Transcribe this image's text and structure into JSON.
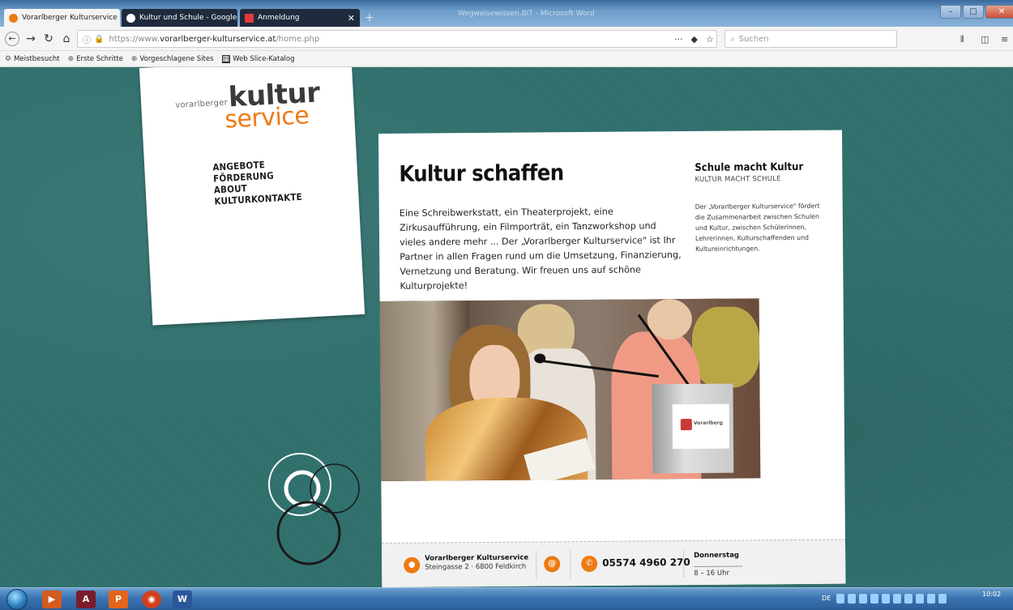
{
  "browser": {
    "tabs": [
      {
        "label": "Vorarlberger Kulturservice",
        "active": true
      },
      {
        "label": "Kultur und Schule - Google-Su",
        "active": false
      },
      {
        "label": "Anmeldung",
        "active": false
      }
    ],
    "window_title": "Wegweisewissen.BIT - Microsoft Word",
    "url_prefix": "https://www.",
    "url_domain": "vorarlberger-kulturservice.at",
    "url_path": "/home.php",
    "page_actions": "···",
    "search_placeholder": "Suchen",
    "bookmarks": [
      "Meistbesucht",
      "Erste Schritte",
      "Vorgeschlagene Sites",
      "Web Slice-Katalog"
    ]
  },
  "site": {
    "logo_small": "vorarlberger",
    "logo_kultur": "kultur",
    "logo_service": "service",
    "nav": [
      "ANGEBOTE",
      "FÖRDERUNG",
      "ABOUT",
      "KULTURKONTAKTE"
    ],
    "heading": "Kultur schaffen",
    "intro": "Eine Schreibwerkstatt, ein Theaterprojekt, eine Zirkusaufführung, ein Filmporträt, ein Tanzworkshop und vieles andere mehr ... Der „Vorarlberger Kulturservice\" ist Ihr Partner in allen Fragen rund um die Umsetzung, Finanzierung, Vernetzung und Beratung. Wir freuen uns auf schöne Kulturprojekte!",
    "side_title": "Schule macht Kultur",
    "side_subtitle": "KULTUR MACHT SCHULE",
    "side_text": "Der „Vorarlberger Kulturservice\" fördert die Zusammenarbeit zwischen Schulen und Kultur, zwischen Schülerinnen, Lehrerinnen, Kulturschaffenden und Kultureinrichtungen.",
    "photo_sign": "Vorarlberg",
    "footer": {
      "org": "Vorarlberger Kulturservice",
      "address": "Steingasse 2 · 6800 Feldkirch",
      "email_icon": "@",
      "phone": "05574 4960 270",
      "day": "Donnerstag",
      "hours": "8 – 16 Uhr"
    }
  },
  "taskbar": {
    "lang": "DE",
    "time": "10:02"
  },
  "colors": {
    "accent": "#ee7a12",
    "background": "#2f6f6c"
  }
}
